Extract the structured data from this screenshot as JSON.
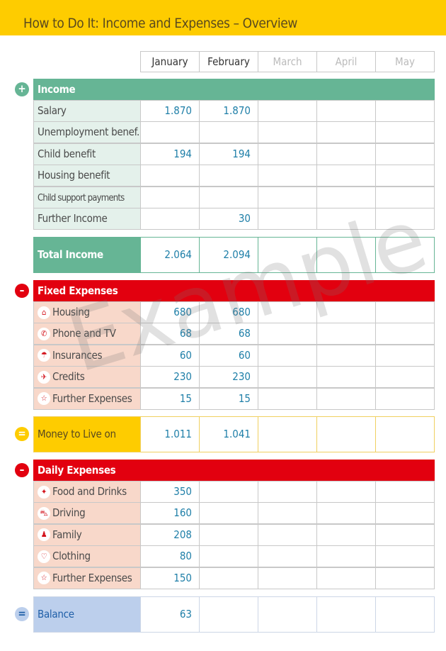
{
  "title": "How to Do It: Income and Expenses – Overview",
  "watermark": "Example",
  "months": [
    "January",
    "February",
    "March",
    "April",
    "May"
  ],
  "colors": {
    "header": "#fecc00",
    "income": "#66b595",
    "expense": "#e2000f",
    "money": "#fecc00",
    "balance": "#bccfec",
    "value": "#1f7fa8"
  },
  "income": {
    "title": "Income",
    "sign": "+",
    "rows": [
      {
        "label": "Salary",
        "values": [
          "1.870",
          "1.870",
          "",
          "",
          ""
        ]
      },
      {
        "label": "Unemployment benef.",
        "values": [
          "",
          "",
          "",
          "",
          ""
        ]
      },
      {
        "label": "Child benefit",
        "values": [
          "194",
          "194",
          "",
          "",
          ""
        ]
      },
      {
        "label": "Housing benefit",
        "values": [
          "",
          "",
          "",
          "",
          ""
        ]
      },
      {
        "label": "Child support payments",
        "values": [
          "",
          "",
          "",
          "",
          ""
        ]
      },
      {
        "label": "Further Income",
        "values": [
          "",
          "30",
          "",
          "",
          ""
        ]
      }
    ],
    "total": {
      "label": "Total Income",
      "values": [
        "2.064",
        "2.094",
        "",
        "",
        ""
      ]
    }
  },
  "fixed": {
    "title": "Fixed Expenses",
    "sign": "–",
    "rows": [
      {
        "label": "Housing",
        "icon": "house-icon",
        "values": [
          "680",
          "680",
          "",
          "",
          ""
        ]
      },
      {
        "label": "Phone and TV",
        "icon": "phone-icon",
        "values": [
          "68",
          "68",
          "",
          "",
          ""
        ]
      },
      {
        "label": "Insurances",
        "icon": "umbrella-icon",
        "values": [
          "60",
          "60",
          "",
          "",
          ""
        ]
      },
      {
        "label": "Credits",
        "icon": "credit-icon",
        "values": [
          "230",
          "230",
          "",
          "",
          ""
        ]
      },
      {
        "label": "Further Expenses",
        "icon": "star-icon",
        "values": [
          "15",
          "15",
          "",
          "",
          ""
        ]
      }
    ]
  },
  "money": {
    "sign": "=",
    "label": "Money to Live on",
    "values": [
      "1.011",
      "1.041",
      "",
      "",
      ""
    ]
  },
  "daily": {
    "title": "Daily Expenses",
    "sign": "–",
    "rows": [
      {
        "label": "Food and Drinks",
        "icon": "food-icon",
        "values": [
          "350",
          "",
          "",
          "",
          ""
        ]
      },
      {
        "label": "Driving",
        "icon": "car-icon",
        "values": [
          "160",
          "",
          "",
          "",
          ""
        ]
      },
      {
        "label": "Family",
        "icon": "family-icon",
        "values": [
          "208",
          "",
          "",
          "",
          ""
        ]
      },
      {
        "label": "Clothing",
        "icon": "shirt-icon",
        "values": [
          "80",
          "",
          "",
          "",
          ""
        ]
      },
      {
        "label": "Further Expenses",
        "icon": "star-icon",
        "values": [
          "150",
          "",
          "",
          "",
          ""
        ]
      }
    ]
  },
  "balance": {
    "sign": "=",
    "label": "Balance",
    "values": [
      "63",
      "",
      "",
      "",
      ""
    ]
  }
}
